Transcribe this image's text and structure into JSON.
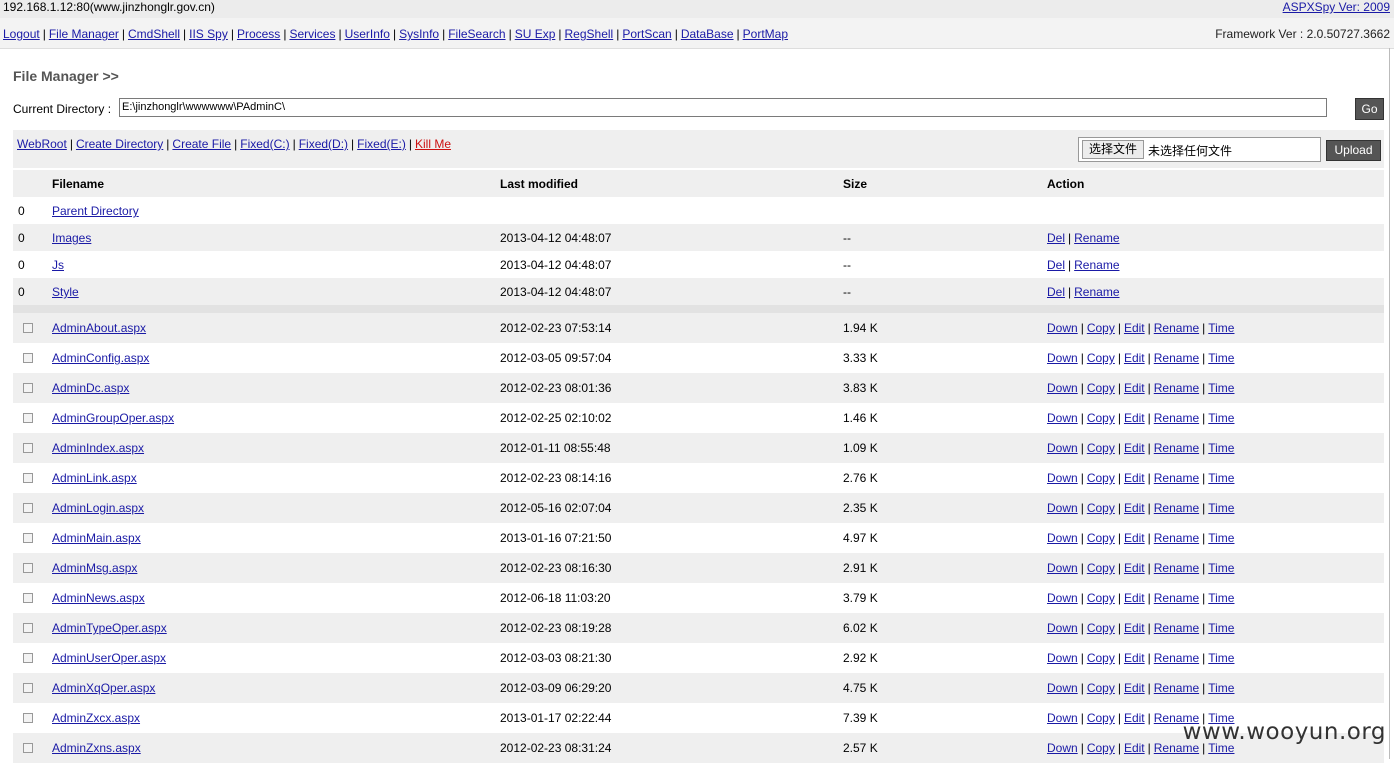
{
  "header": {
    "host": "192.168.1.12:80(www.jinzhonglr.gov.cn)",
    "version": "ASPXSpy Ver: 2009"
  },
  "nav": {
    "items": [
      "Logout",
      "File Manager",
      "CmdShell",
      "IIS Spy",
      "Process",
      "Services",
      "UserInfo",
      "SysInfo",
      "FileSearch",
      "SU Exp",
      "RegShell",
      "PortScan",
      "DataBase",
      "PortMap"
    ],
    "framework": "Framework Ver : 2.0.50727.3662"
  },
  "page": {
    "title": "File Manager >>",
    "current_dir_label": "Current Directory :",
    "current_dir_value": "E:\\jinzhonglr\\wwwwww\\PAdminC\\",
    "go_label": "Go"
  },
  "toolbar": {
    "links": [
      "WebRoot",
      "Create Directory",
      "Create File",
      "Fixed(C:)",
      "Fixed(D:)",
      "Fixed(E:)"
    ],
    "kill": "Kill Me",
    "choose_file": "选择文件",
    "no_file": "未选择任何文件",
    "upload": "Upload"
  },
  "table": {
    "headers": [
      "Filename",
      "Last modified",
      "Size",
      "Action"
    ],
    "parent": {
      "num": "0",
      "name": "Parent Directory"
    },
    "dirs": [
      {
        "num": "0",
        "name": "Images",
        "modified": "2013-04-12 04:48:07",
        "size": "--"
      },
      {
        "num": "0",
        "name": "Js",
        "modified": "2013-04-12 04:48:07",
        "size": "--"
      },
      {
        "num": "0",
        "name": "Style",
        "modified": "2013-04-12 04:48:07",
        "size": "--"
      }
    ],
    "dir_actions": [
      "Del",
      "Rename"
    ],
    "files": [
      {
        "name": "AdminAbout.aspx",
        "modified": "2012-02-23 07:53:14",
        "size": "1.94 K"
      },
      {
        "name": "AdminConfig.aspx",
        "modified": "2012-03-05 09:57:04",
        "size": "3.33 K"
      },
      {
        "name": "AdminDc.aspx",
        "modified": "2012-02-23 08:01:36",
        "size": "3.83 K"
      },
      {
        "name": "AdminGroupOper.aspx",
        "modified": "2012-02-25 02:10:02",
        "size": "1.46 K"
      },
      {
        "name": "AdminIndex.aspx",
        "modified": "2012-01-11 08:55:48",
        "size": "1.09 K"
      },
      {
        "name": "AdminLink.aspx",
        "modified": "2012-02-23 08:14:16",
        "size": "2.76 K"
      },
      {
        "name": "AdminLogin.aspx",
        "modified": "2012-05-16 02:07:04",
        "size": "2.35 K"
      },
      {
        "name": "AdminMain.aspx",
        "modified": "2013-01-16 07:21:50",
        "size": "4.97 K"
      },
      {
        "name": "AdminMsg.aspx",
        "modified": "2012-02-23 08:16:30",
        "size": "2.91 K"
      },
      {
        "name": "AdminNews.aspx",
        "modified": "2012-06-18 11:03:20",
        "size": "3.79 K"
      },
      {
        "name": "AdminTypeOper.aspx",
        "modified": "2012-02-23 08:19:28",
        "size": "6.02 K"
      },
      {
        "name": "AdminUserOper.aspx",
        "modified": "2012-03-03 08:21:30",
        "size": "2.92 K"
      },
      {
        "name": "AdminXqOper.aspx",
        "modified": "2012-03-09 06:29:20",
        "size": "4.75 K"
      },
      {
        "name": "AdminZxcx.aspx",
        "modified": "2013-01-17 02:22:44",
        "size": "7.39 K"
      },
      {
        "name": "AdminZxns.aspx",
        "modified": "2012-02-23 08:31:24",
        "size": "2.57 K"
      }
    ],
    "file_actions": [
      "Down",
      "Copy",
      "Edit",
      "Rename",
      "Time"
    ]
  },
  "watermark": "www.wooyun.org",
  "colors": {
    "link": "#1a1aa6",
    "kill": "#cc1111",
    "row_alt": "#efefef",
    "button_dark": "#555555"
  }
}
